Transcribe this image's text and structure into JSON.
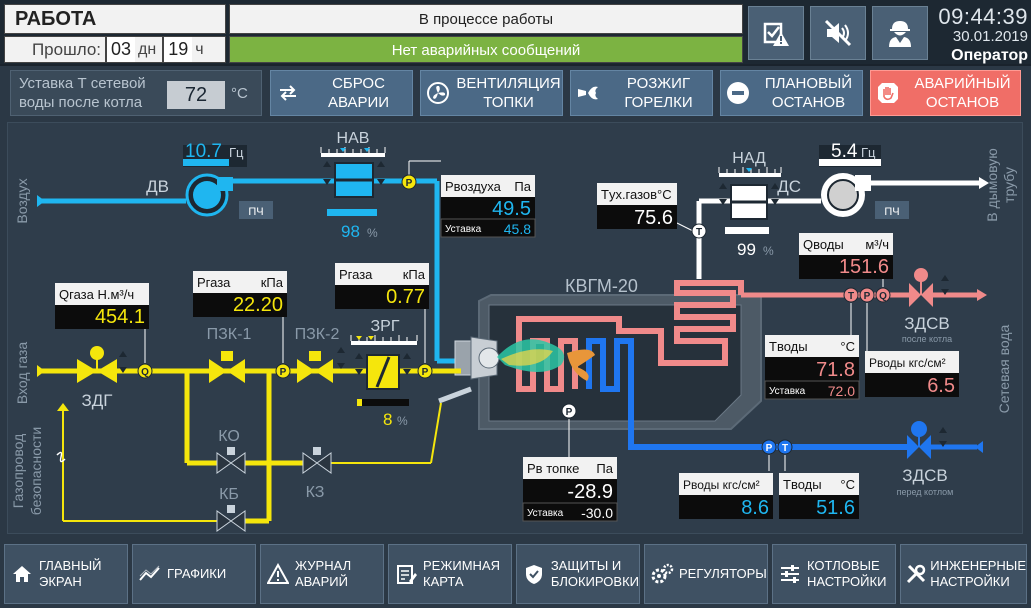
{
  "header": {
    "mode": "РАБОТА",
    "elapsed_label": "Прошло:",
    "elapsed_days": "03",
    "days_unit": "дн",
    "elapsed_hours": "19",
    "hours_unit": "ч",
    "status": "В процессе работы",
    "alarms": "Нет аварийных сообщений",
    "time": "09:44:39",
    "date": "30.01.2019",
    "role": "Оператор",
    "buttons": [
      "ack-alarms-icon",
      "mute-sound-icon",
      "operator-icon"
    ]
  },
  "commands": {
    "setpoint_label_1": "Уставка Т сетевой",
    "setpoint_label_2": "воды после котла",
    "setpoint_value": "72",
    "setpoint_unit": "°C",
    "reset": [
      "СБРОС",
      "АВАРИИ"
    ],
    "vent": [
      "ВЕНТИЛЯЦИЯ",
      "ТОПКИ"
    ],
    "ignite": [
      "РОЗЖИГ",
      "ГОРЕЛКИ"
    ],
    "stop": [
      "ПЛАНОВЫЙ",
      "ОСТАНОВ"
    ],
    "estop": [
      "АВАРИЙНЫЙ",
      "ОСТАНОВ"
    ]
  },
  "scheme": {
    "air_in": "Воздух",
    "gas_in": "Вход газа",
    "safety_pipe_1": "Газопровод",
    "safety_pipe_2": "безопасности",
    "flue_1": "В дымовую",
    "flue_2": "трубу",
    "network_water": "Сетевая вода",
    "boiler": "КВГМ-20",
    "dv": "ДВ",
    "dv_freq": "10.7",
    "freq_unit": "Гц",
    "pch": "ПЧ",
    "nav": "НАВ",
    "nav_pos": "98",
    "pct": "%",
    "nad": "НАД",
    "nad_pos": "99",
    "ds": "ДС",
    "ds_freq": "5.4",
    "zdg": "ЗДГ",
    "pzk1": "ПЗК-1",
    "pzk2": "ПЗК-2",
    "zrg": "ЗРГ",
    "zrg_pos": "8",
    "ko": "КО",
    "kb": "КБ",
    "kz": "КЗ",
    "zdsv_out": "ЗДСВ",
    "zdsv_out_sub": "после котла",
    "zdsv_in": "ЗДСВ",
    "zdsv_in_sub": "перед котлом",
    "setpoint": "Уставка",
    "p_air": {
      "name": "Pвоздуха",
      "unit": "Па",
      "value": "49.5",
      "sp": "45.8"
    },
    "q_gas": {
      "name": "Qгаза Н.м³/ч",
      "value": "454.1"
    },
    "p_gas1": {
      "name": "Pгаза",
      "unit": "кПа",
      "value": "22.20"
    },
    "p_gas2": {
      "name": "Pгаза",
      "unit": "кПа",
      "value": "0.77"
    },
    "t_flue": {
      "name": "Tух.газов°C",
      "value": "75.6"
    },
    "q_water": {
      "name": "Qводы",
      "unit": "м³/ч",
      "value": "151.6"
    },
    "t_water_out": {
      "name": "Tводы",
      "unit": "°C",
      "value": "71.8",
      "sp": "72.0"
    },
    "p_water_out": {
      "name": "Pводы кгс/см²",
      "value": "6.5"
    },
    "p_furnace": {
      "name": "Pв топке",
      "unit": "Па",
      "value": "-28.9",
      "sp": "-30.0"
    },
    "p_water_in": {
      "name": "Pводы кгс/см²",
      "value": "8.6"
    },
    "t_water_in": {
      "name": "Tводы",
      "unit": "°C",
      "value": "51.6"
    },
    "sensor_q": "Q",
    "sensor_p": "P",
    "sensor_t": "T"
  },
  "nav": [
    {
      "l1": "ГЛАВНЫЙ",
      "l2": "ЭКРАН",
      "icon": "home-icon"
    },
    {
      "l1": "ГРАФИКИ",
      "l2": "",
      "icon": "chart-icon"
    },
    {
      "l1": "ЖУРНАЛ",
      "l2": "АВАРИЙ",
      "icon": "alarm-log-icon"
    },
    {
      "l1": "РЕЖИМНАЯ",
      "l2": "КАРТА",
      "icon": "mode-map-icon"
    },
    {
      "l1": "ЗАЩИТЫ И",
      "l2": "БЛОКИРОВКИ",
      "icon": "shield-icon"
    },
    {
      "l1": "РЕГУЛЯТОРЫ",
      "l2": "",
      "icon": "gears-icon"
    },
    {
      "l1": "КОТЛОВЫЕ",
      "l2": "НАСТРОЙКИ",
      "icon": "sliders-icon"
    },
    {
      "l1": "ИНЖЕНЕРНЫЕ",
      "l2": "НАСТРОЙКИ",
      "icon": "tools-icon"
    }
  ],
  "colors": {
    "air": "#1fb6f0",
    "gas": "#f5e60c",
    "hot_water": "#f08a8a",
    "cold_water": "#1f76f0",
    "flue": "#ffffff"
  }
}
